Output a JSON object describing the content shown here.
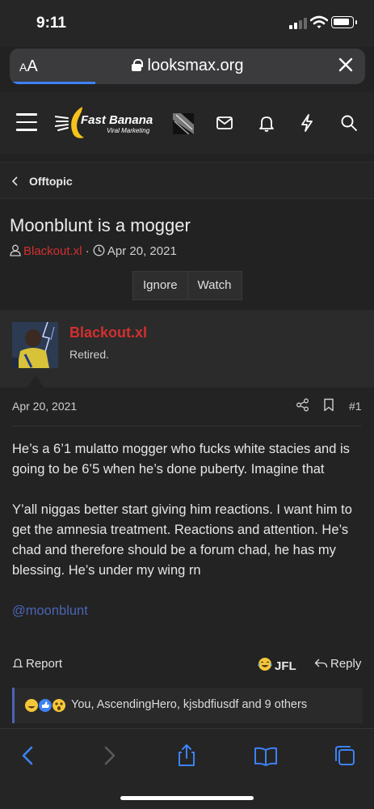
{
  "status_bar": {
    "time": "9:11",
    "icons": [
      "cellular-signal-icon",
      "wifi-icon",
      "battery-icon"
    ]
  },
  "url_bar": {
    "text_size_label": "AA",
    "url": "looksmax.org",
    "load_progress": 0.24,
    "icons": [
      "lock-icon",
      "close-icon"
    ]
  },
  "site_header": {
    "logo_title": "Fast Banana",
    "logo_subtitle": "Viral Marketing",
    "icons": [
      "menu-icon",
      "user-avatar",
      "inbox-icon",
      "alerts-icon",
      "whats-new-icon",
      "search-icon"
    ]
  },
  "breadcrumb": {
    "label": "Offtopic"
  },
  "thread": {
    "title": "Moonblunt is a mogger",
    "author": "Blackout.xl",
    "separator": "·",
    "date": "Apr 20, 2021",
    "buttons": {
      "ignore": "Ignore",
      "watch": "Watch"
    }
  },
  "post": {
    "author": "Blackout.xl",
    "user_title": "Retired.",
    "date": "Apr 20, 2021",
    "number": "#1",
    "paragraphs": [
      "He’s a 6’1 mulatto mogger who fucks white stacies and is going to be 6’5 when he’s done puberty. Imagine that",
      "Y’all niggas better start giving him reactions. I want him to get the amnesia treatment. Reactions and attention. He’s chad and therefore should be a forum chad, he has my blessing. He’s under my wing rn"
    ],
    "mention": "@moonblunt",
    "actions": {
      "report": "Report",
      "reaction": "JFL",
      "reply": "Reply"
    },
    "reactions_summary": "You, AscendingHero, kjsbdfiusdf and 9 others"
  },
  "colors": {
    "background": "#222222",
    "username": "#d32f2f",
    "accent_blue": "#4a64b5",
    "safari_blue": "#3d82f5"
  },
  "toolbar": {
    "icons": [
      "back-icon",
      "forward-icon",
      "share-icon",
      "bookmarks-icon",
      "tabs-icon"
    ]
  }
}
